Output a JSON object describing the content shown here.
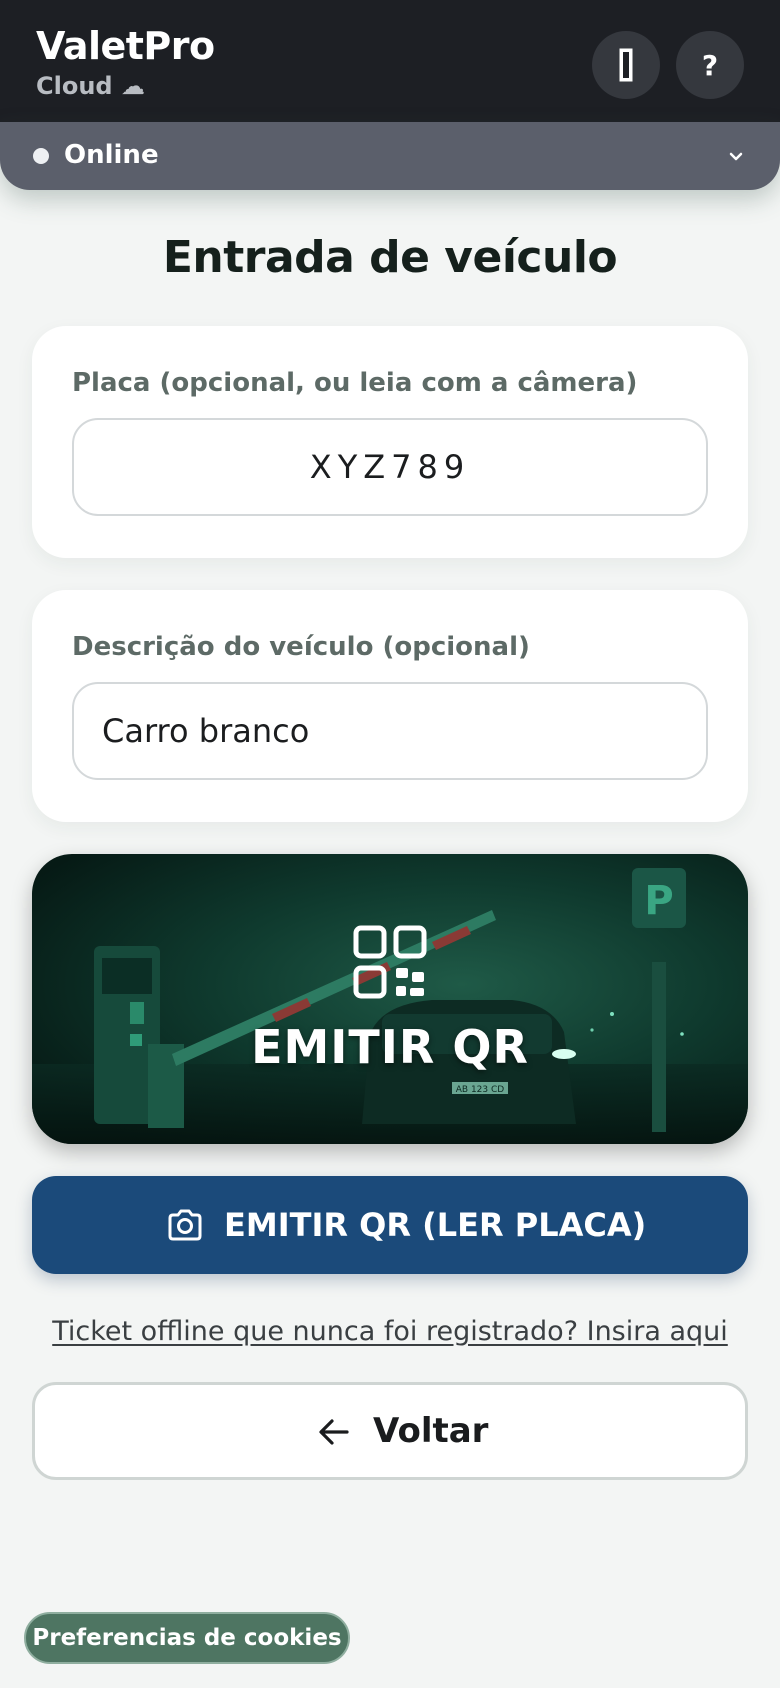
{
  "header": {
    "brand": "ValetPro",
    "subtitle": "Cloud ☁",
    "help_label": "?",
    "theme_icon": "bw-rectangle-icon"
  },
  "status": {
    "label": "Online",
    "dot_color": "#eef0f3"
  },
  "page": {
    "title": "Entrada de veículo"
  },
  "plate_field": {
    "label": "Placa (opcional, ou leia com a câmera)",
    "value": "XYZ789"
  },
  "description_field": {
    "label": "Descrição do veículo (opcional)",
    "value": "Carro branco"
  },
  "hero_button": {
    "label": "EMITIR QR",
    "icon": "qr-code-icon",
    "car_plate_text": "AB 123 CD"
  },
  "scan_button": {
    "label": "EMITIR QR (LER PLACA)",
    "icon": "camera-icon",
    "color": "#1b4a7a"
  },
  "offline_link": {
    "label": "Ticket offline que nunca foi registrado? Insira aqui"
  },
  "back_button": {
    "label": "Voltar",
    "icon": "arrow-left-icon"
  },
  "cookie_button": {
    "label": "Preferencias de cookies"
  },
  "colors": {
    "header_bg": "#1d1f24",
    "status_bg": "#5b5f6b",
    "page_bg": "#f3f5f4",
    "accent_green": "#1f8f66"
  }
}
